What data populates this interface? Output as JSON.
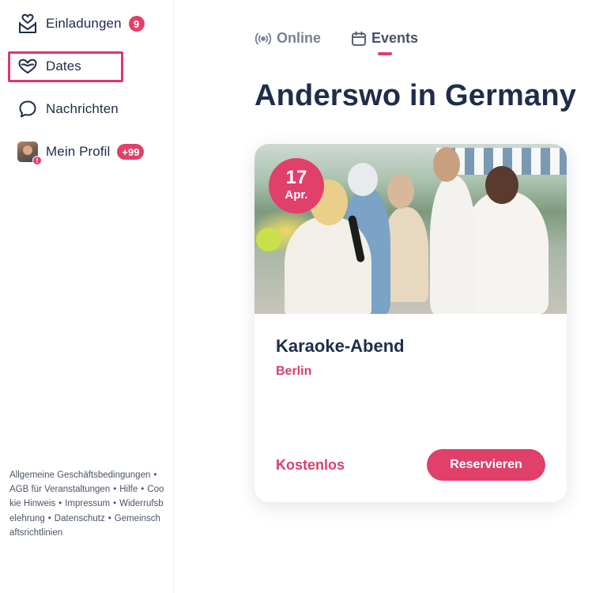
{
  "sidebar": {
    "items": [
      {
        "label": "Einladungen",
        "badge": "9",
        "icon": "heart-envelope-icon"
      },
      {
        "label": "Dates",
        "icon": "heart-outline-icon"
      },
      {
        "label": "Nachrichten",
        "icon": "speech-bubble-icon"
      },
      {
        "label": "Mein Profil",
        "badge": "+99",
        "icon": "avatar-icon",
        "alert": "!"
      }
    ],
    "footer_links": [
      "Allgemeine Geschäftsbedingungen",
      "AGB für Veranstaltungen",
      "Hilfe",
      "Cookie Hinweis",
      "Impressum",
      "Widerrufsbelehrung",
      "Datenschutz",
      "Gemeinschaftsrichtlinien"
    ],
    "footer_separator": "•"
  },
  "tabs": [
    {
      "label": "Online",
      "icon": "broadcast-icon",
      "active": false
    },
    {
      "label": "Events",
      "icon": "calendar-icon",
      "active": true
    }
  ],
  "page": {
    "title": "Anderswo in Germany"
  },
  "event": {
    "date_day": "17",
    "date_month": "Apr.",
    "title": "Karaoke-Abend",
    "city": "Berlin",
    "price": "Kostenlos",
    "button_label": "Reservieren",
    "image": "karaoke-party-photo"
  },
  "colors": {
    "accent": "#e0406a",
    "text_dark": "#1f2d4a",
    "highlight_border": "#e0356c"
  }
}
